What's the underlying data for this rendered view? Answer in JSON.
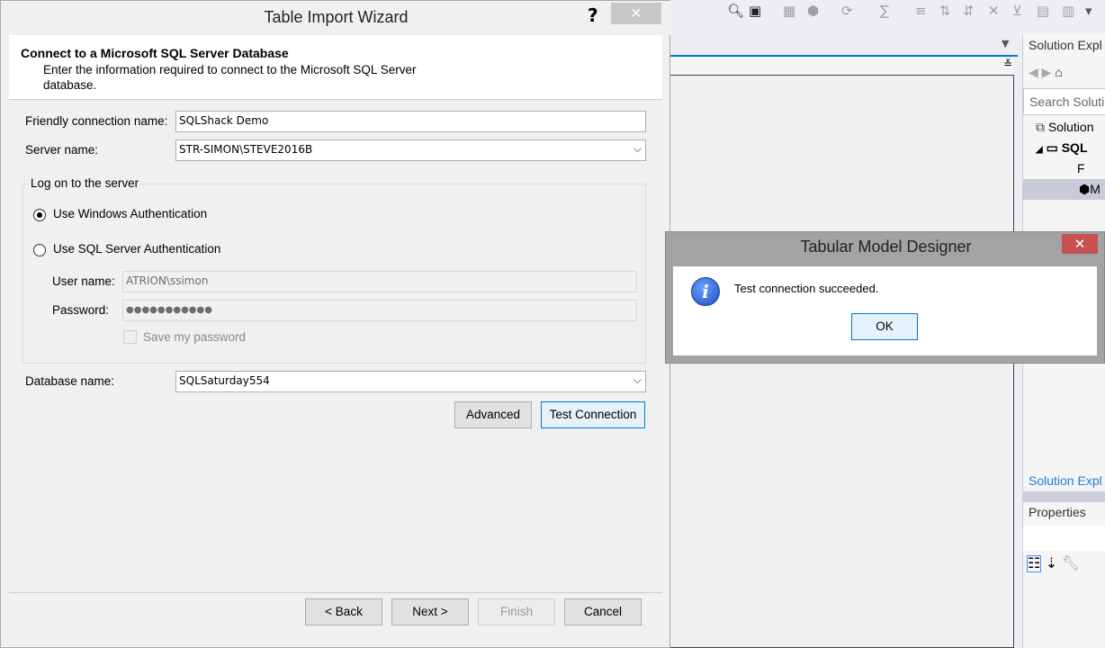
{
  "wizard": {
    "title": "Table Import Wizard",
    "help_label": "?",
    "close_label": "✕",
    "header": {
      "title": "Connect to a Microsoft SQL Server Database",
      "subtitle_line1": "Enter the information required to connect to the Microsoft SQL Server",
      "subtitle_line2": "database."
    },
    "friendly_name": {
      "label": "Friendly connection name:",
      "value": "SQLShack Demo"
    },
    "server_name": {
      "label": "Server name:",
      "value": "STR-SIMON\\STEVE2016B"
    },
    "logon_group": "Log on to the server",
    "windows_auth": "Use Windows Authentication",
    "sql_auth": "Use SQL Server Authentication",
    "user_name": {
      "label": "User name:",
      "value": "ATRION\\ssimon"
    },
    "password": {
      "label": "Password:",
      "value": "●●●●●●●●●●●"
    },
    "save_password": "Save my password",
    "database_name": {
      "label": "Database name:",
      "value": "SQLSaturday554"
    },
    "advanced": "Advanced",
    "test_connection": "Test Connection",
    "back": "< Back",
    "next": "Next >",
    "finish": "Finish",
    "cancel": "Cancel"
  },
  "message_box": {
    "title": "Tabular Model Designer",
    "close_label": "✕",
    "message": "Test connection succeeded.",
    "ok": "OK",
    "icon": "info-icon"
  },
  "vs": {
    "solution_explorer_title": "Solution Expl",
    "search_placeholder": "Search Soluti",
    "tree": [
      "Solution",
      "SQL",
      "F",
      "M"
    ],
    "solution_explorer_tab": "Solution Expl",
    "properties_title": "Properties"
  }
}
